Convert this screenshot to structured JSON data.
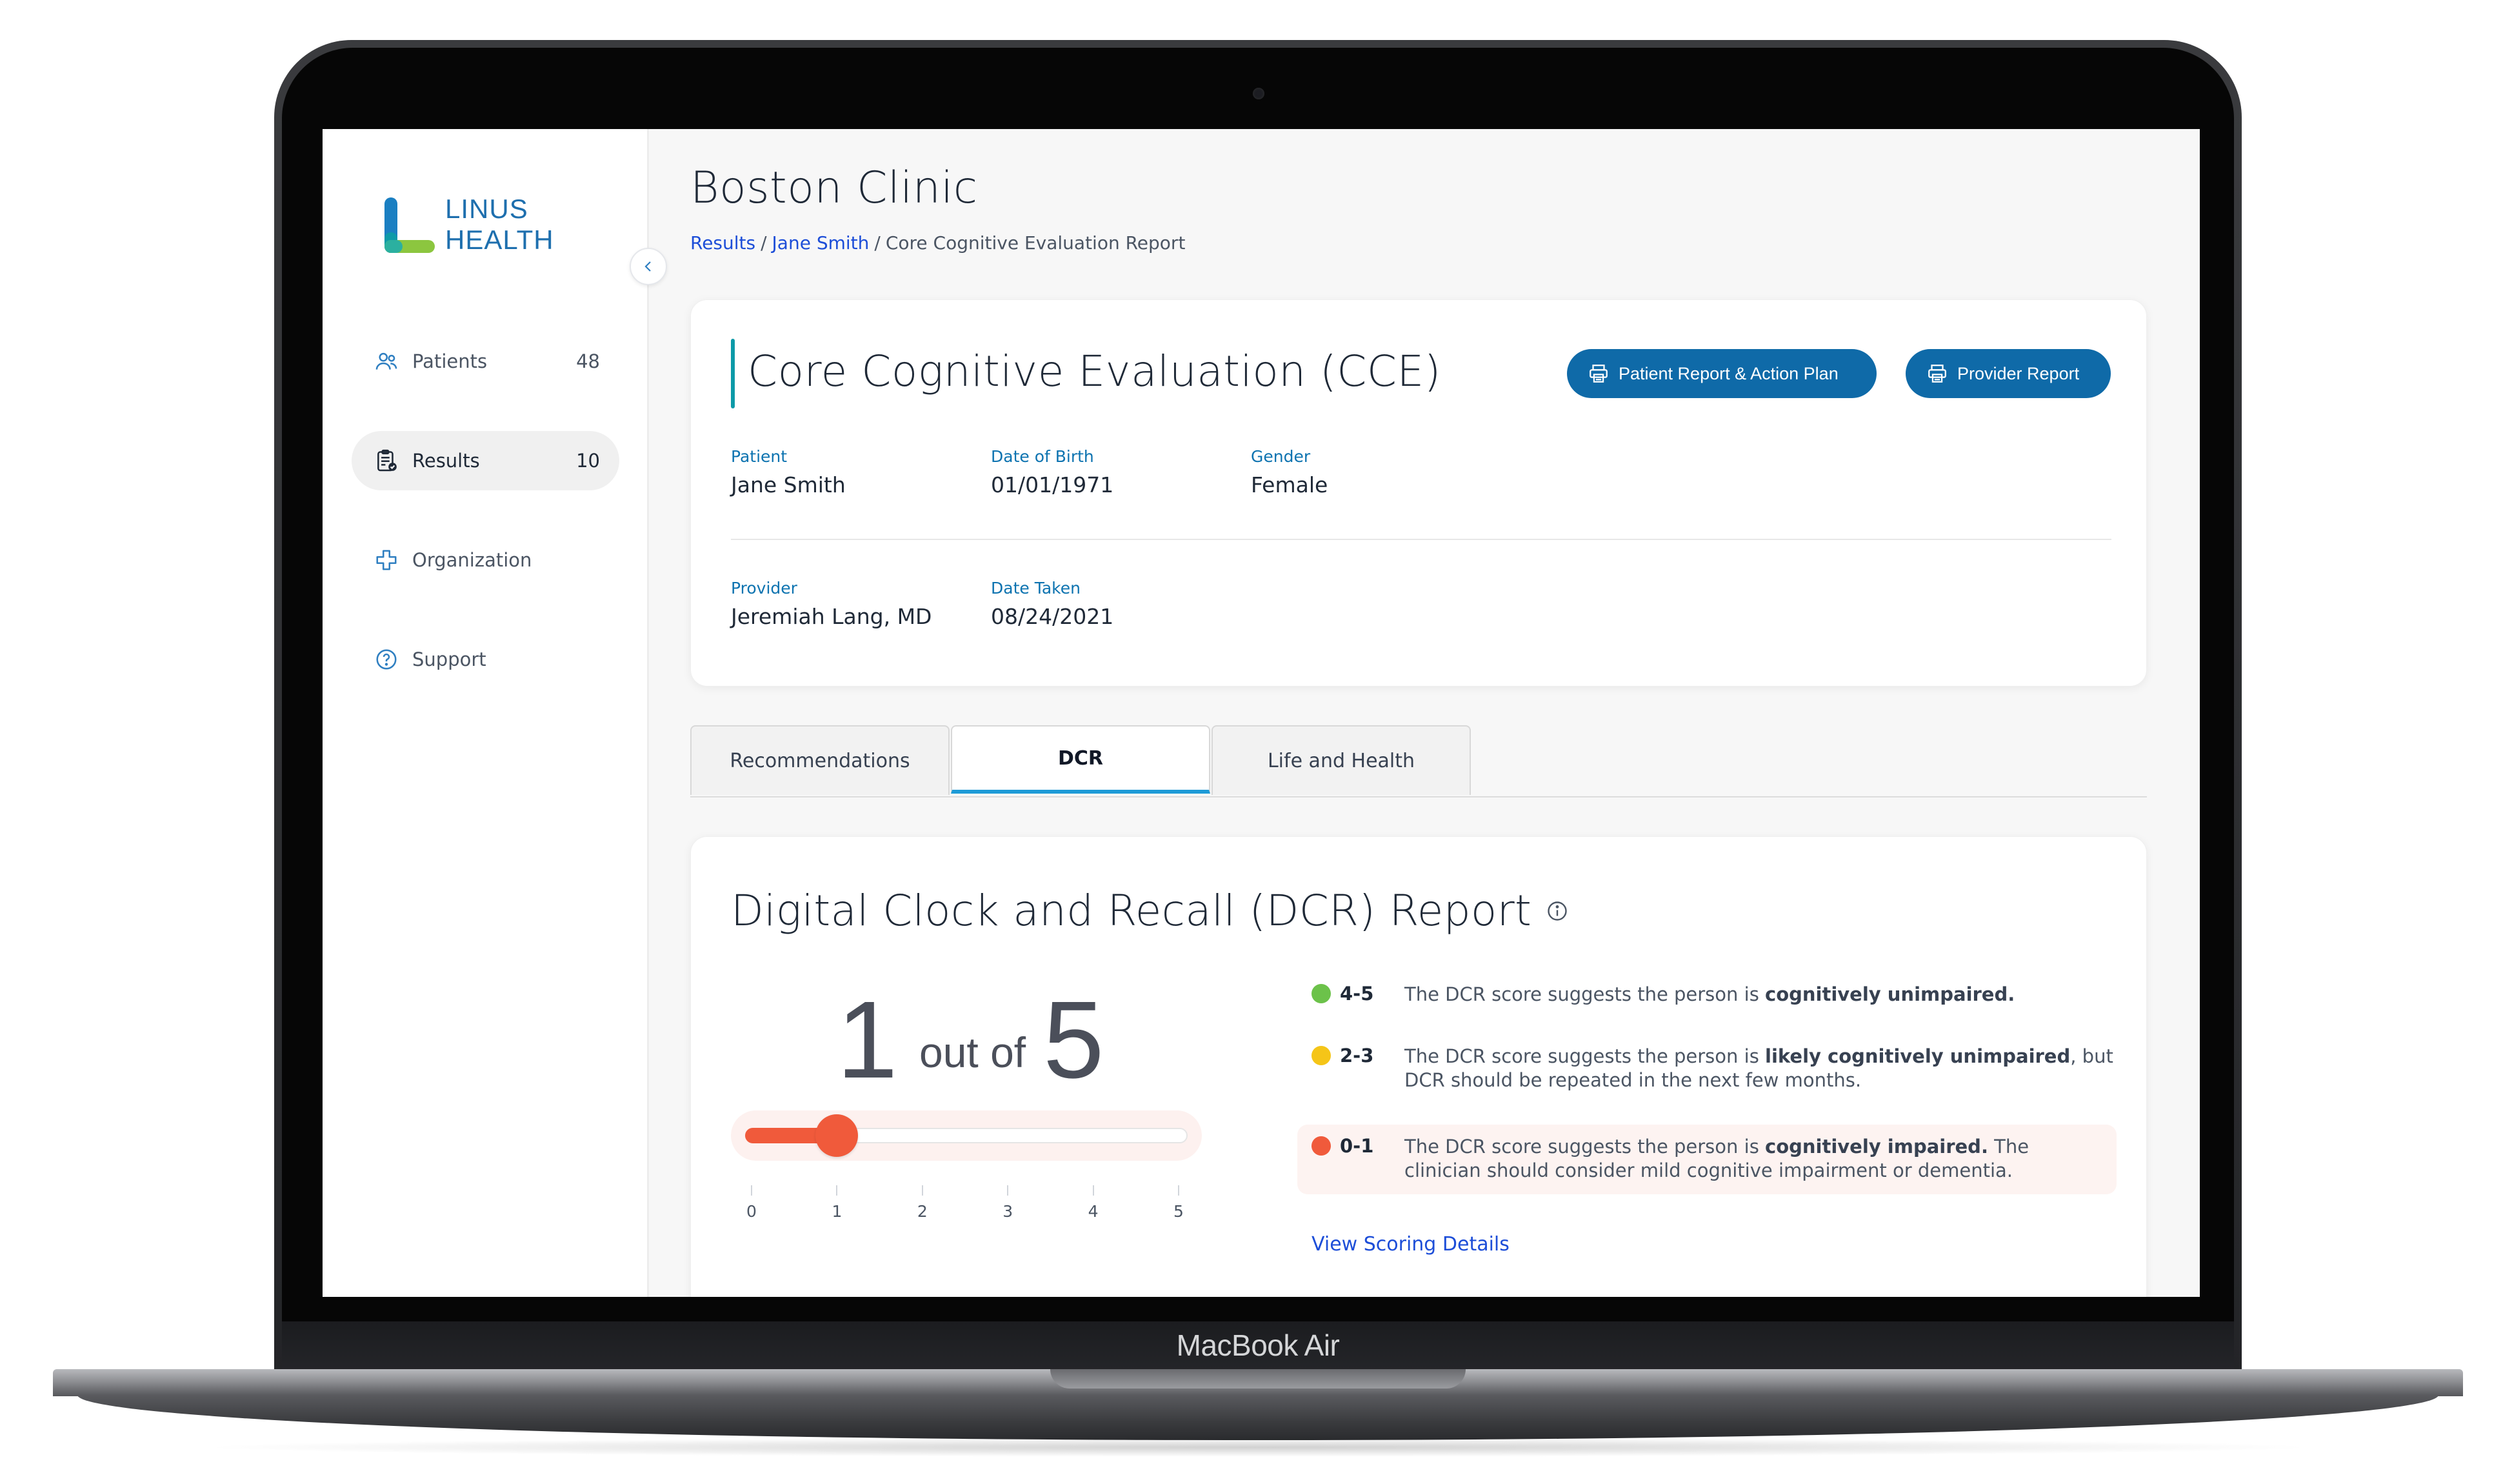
{
  "device": {
    "label": "MacBook Air"
  },
  "sidebar": {
    "logo": {
      "line1": "LINUS",
      "line2": "HEALTH"
    },
    "items": [
      {
        "label": "Patients",
        "count": "48",
        "icon": "users-icon",
        "active": false
      },
      {
        "label": "Results",
        "count": "10",
        "icon": "clipboard-icon",
        "active": true
      },
      {
        "label": "Organization",
        "count": "",
        "icon": "medical-cross-icon",
        "active": false
      },
      {
        "label": "Support",
        "count": "",
        "icon": "help-circle-icon",
        "active": false
      }
    ]
  },
  "header": {
    "title": "Boston Clinic",
    "breadcrumb": {
      "results": "Results",
      "patient": "Jane Smith",
      "current": "Core Cognitive Evaluation Report",
      "separator": "/"
    }
  },
  "summary": {
    "title": "Core Cognitive Evaluation (CCE)",
    "buttons": {
      "patient_report": "Patient Report & Action Plan",
      "provider_report": "Provider Report"
    },
    "fields": {
      "patient": {
        "label": "Patient",
        "value": "Jane Smith"
      },
      "dob": {
        "label": "Date of Birth",
        "value": "01/01/1971"
      },
      "gender": {
        "label": "Gender",
        "value": "Female"
      },
      "provider": {
        "label": "Provider",
        "value": "Jeremiah Lang, MD"
      },
      "date_taken": {
        "label": "Date Taken",
        "value": "08/24/2021"
      }
    }
  },
  "tabs": [
    {
      "label": "Recommendations",
      "active": false
    },
    {
      "label": "DCR",
      "active": true
    },
    {
      "label": "Life and Health",
      "active": false
    }
  ],
  "dcr": {
    "title": "Digital Clock and Recall (DCR) Report",
    "score": {
      "value": "1",
      "out_of_label": "out of",
      "max": "5",
      "value_num": 1,
      "max_num": 5
    },
    "ticks": [
      "0",
      "1",
      "2",
      "3",
      "4",
      "5"
    ],
    "legend": [
      {
        "range": "4-5",
        "color": "#6cc24a",
        "text_before": "The DCR score suggests the person is ",
        "bold": "cognitively unimpaired.",
        "text_after": ""
      },
      {
        "range": "2-3",
        "color": "#f5c518",
        "text_before": "The DCR score suggests the person is ",
        "bold": "likely cognitively unimpaired",
        "text_after": ", but DCR should be repeated in the next few months."
      },
      {
        "range": "0-1",
        "color": "#f05a3b",
        "text_before": "The DCR score suggests the person is ",
        "bold": "cognitively impaired.",
        "text_after": " The clinician should consider mild cognitive impairment or dementia."
      }
    ],
    "view_scoring": "View Scoring Details"
  },
  "colors": {
    "primary": "#0f6aa8",
    "accent": "#0d9aa8",
    "link": "#1d4ed8",
    "score_red": "#f05a3b"
  }
}
